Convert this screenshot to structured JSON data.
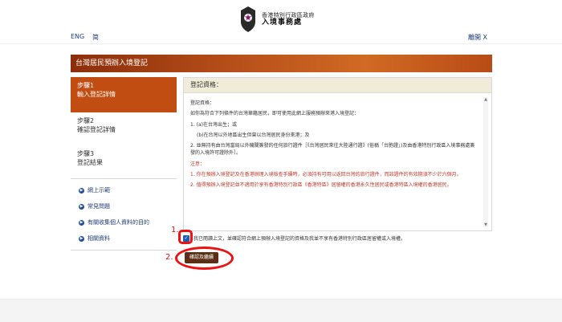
{
  "header": {
    "logo_line1": "香港特別行政區政府",
    "logo_line2": "入境事務處",
    "lang_en": "ENG",
    "lang_sc": "简",
    "exit": "離開 X"
  },
  "title": "台灣居民預辦入境登記",
  "steps": [
    {
      "num": "步驟1",
      "label": "輸入登記詳情",
      "active": true
    },
    {
      "num": "步驟2",
      "label": "確認登記詳情",
      "active": false
    },
    {
      "num": "步驟3",
      "label": "登記結果",
      "active": false
    }
  ],
  "links": [
    "網上示範",
    "常見問題",
    "有關收集個人資料的目的",
    "相關資料"
  ],
  "panel_title": "登記資格：",
  "content": {
    "heading": "登記資格：",
    "intro": "如你為符合下列條件的台灣華籍居民，即可使用此網上服務預辦來港入境登記：",
    "item1": "1. (a)在台灣出生；或",
    "item1b": "(b)在台灣以外地區出生但曾以台灣居民身份來港；及",
    "item2": "2. 並無持有由台灣當局以外機關簽發的任何旅行證件［《台灣居民來往大陸通行證》(俗稱「台胞證」)及由香港特別行政區入境事務處簽發的入境許可證除外］。",
    "notice_label": "注意：",
    "note1": "1. 你在預辦入境登記及在香港辦理入境檢查手續時，必須持有可用以返回台灣的旅行證件，而該證件的有效期須不少於六個月。",
    "note2": "2. 值得預辦入境登記並不適用於享有香港特別行政區《香港特區》居留權的香港永久性居民或香港特區入境權的香港居民。"
  },
  "agree_text": "我已閱讀上文，並確認符合網上預辦入境登記的資格及我並不享有香港特別行政區居留權或入境權。",
  "confirm_button": "確認及繼續",
  "annotations": [
    "1.",
    "2."
  ]
}
